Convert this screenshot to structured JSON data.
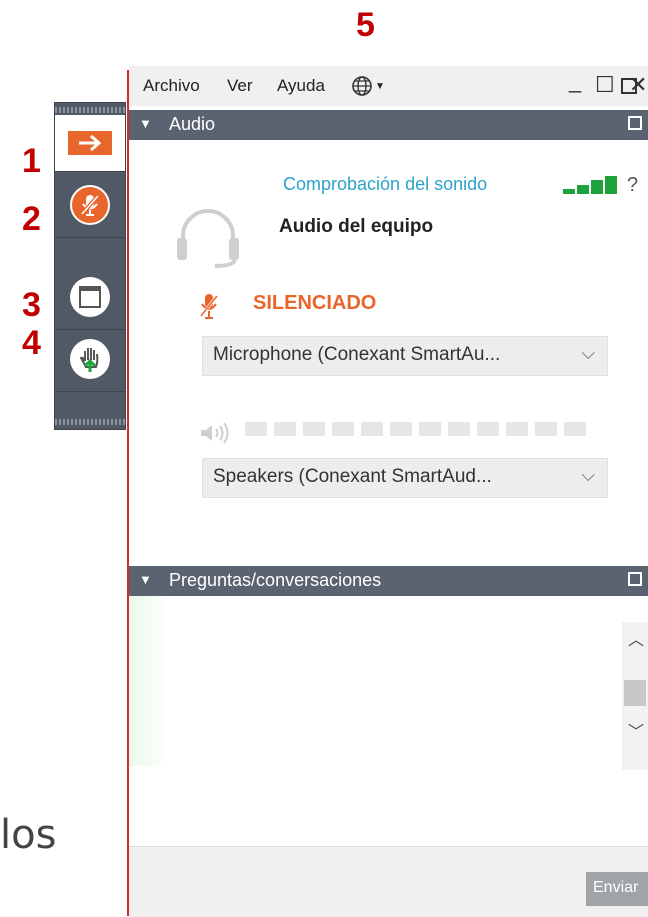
{
  "callouts": [
    "1",
    "2",
    "3",
    "4",
    "5"
  ],
  "background_text": "los",
  "menu": {
    "items": [
      "Archivo",
      "Ver",
      "Ayuda"
    ],
    "language_icon": "globe-icon",
    "window_controls": {
      "minimize": "_",
      "restore": "☐",
      "close": "✕"
    }
  },
  "audio_panel": {
    "title": "Audio",
    "sound_check_link": "Comprobación del sonido",
    "help": "?",
    "audio_source": "Audio del equipo",
    "mute_status": "SILENCIADO",
    "microphone": "Microphone  (Conexant SmartAu...",
    "speakers": "Speakers  (Conexant  SmartAud...",
    "speaker_level_segments": 12
  },
  "questions_panel": {
    "title": "Preguntas/conversaciones",
    "send_button": "Enviar"
  },
  "colors": {
    "panel_header": "#5b6270",
    "accent_orange": "#e8652c",
    "link": "#2aa3c9",
    "callout": "#c00000",
    "signal_green": "#1ea33c"
  }
}
